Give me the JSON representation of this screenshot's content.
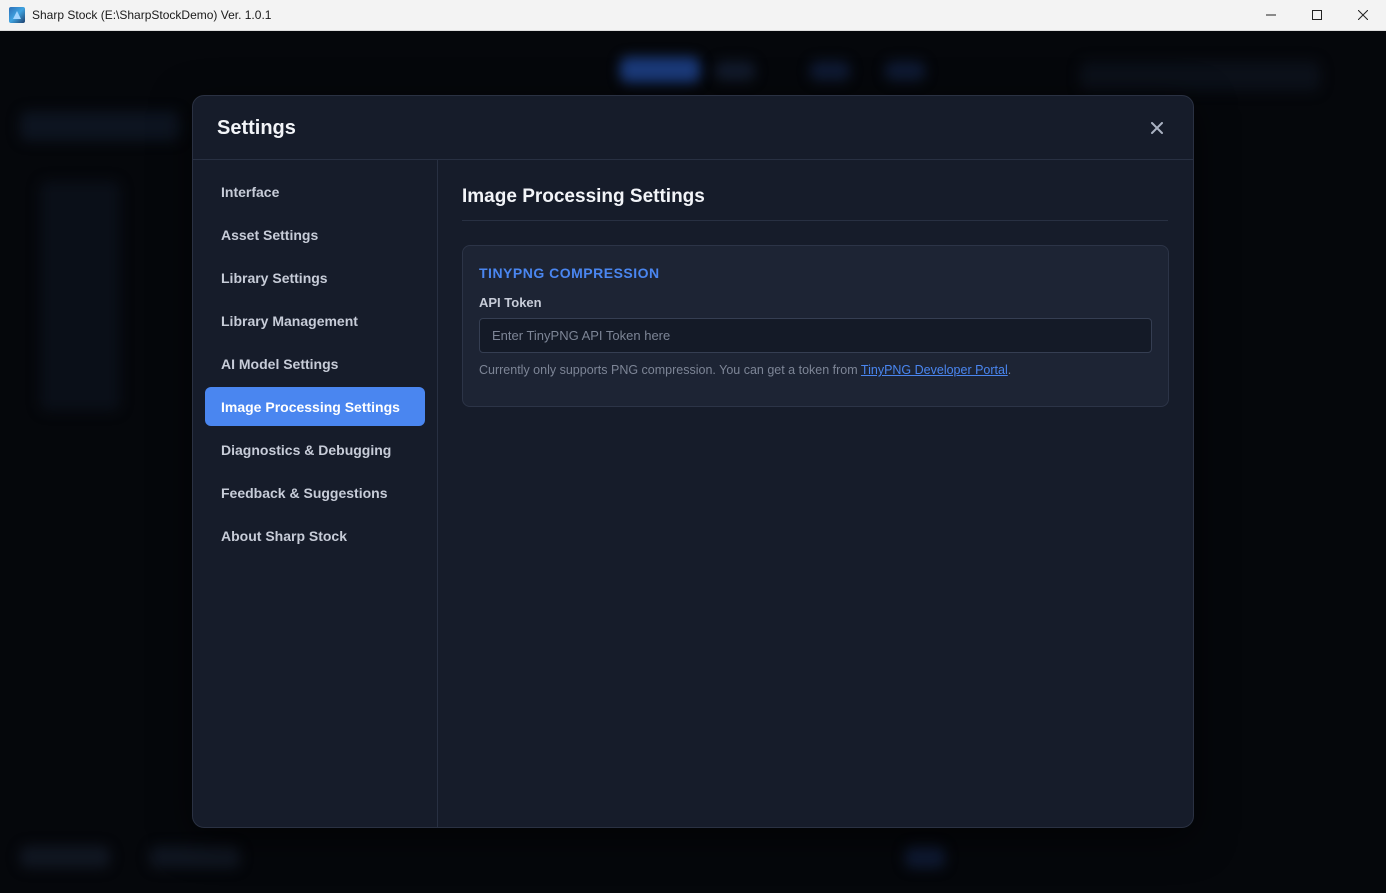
{
  "window": {
    "title": "Sharp Stock (E:\\SharpStockDemo) Ver. 1.0.1"
  },
  "settings": {
    "title": "Settings",
    "close_label": "×",
    "nav": [
      {
        "label": "Interface"
      },
      {
        "label": "Asset Settings"
      },
      {
        "label": "Library Settings"
      },
      {
        "label": "Library Management"
      },
      {
        "label": "AI Model Settings"
      },
      {
        "label": "Image Processing Settings",
        "active": true
      },
      {
        "label": "Diagnostics & Debugging"
      },
      {
        "label": "Feedback & Suggestions"
      },
      {
        "label": "About Sharp Stock"
      }
    ],
    "section_title": "Image Processing Settings",
    "card": {
      "title": "TINYPNG COMPRESSION",
      "field_label": "API Token",
      "input_value": "",
      "input_placeholder": "Enter TinyPNG API Token here",
      "help_prefix": "Currently only supports PNG compression. You can get a token from ",
      "help_link": "TinyPNG Developer Portal",
      "help_suffix": "."
    }
  },
  "colors": {
    "accent": "#4a86f0",
    "modal_bg": "#161c2a",
    "card_bg": "#1d2434"
  }
}
